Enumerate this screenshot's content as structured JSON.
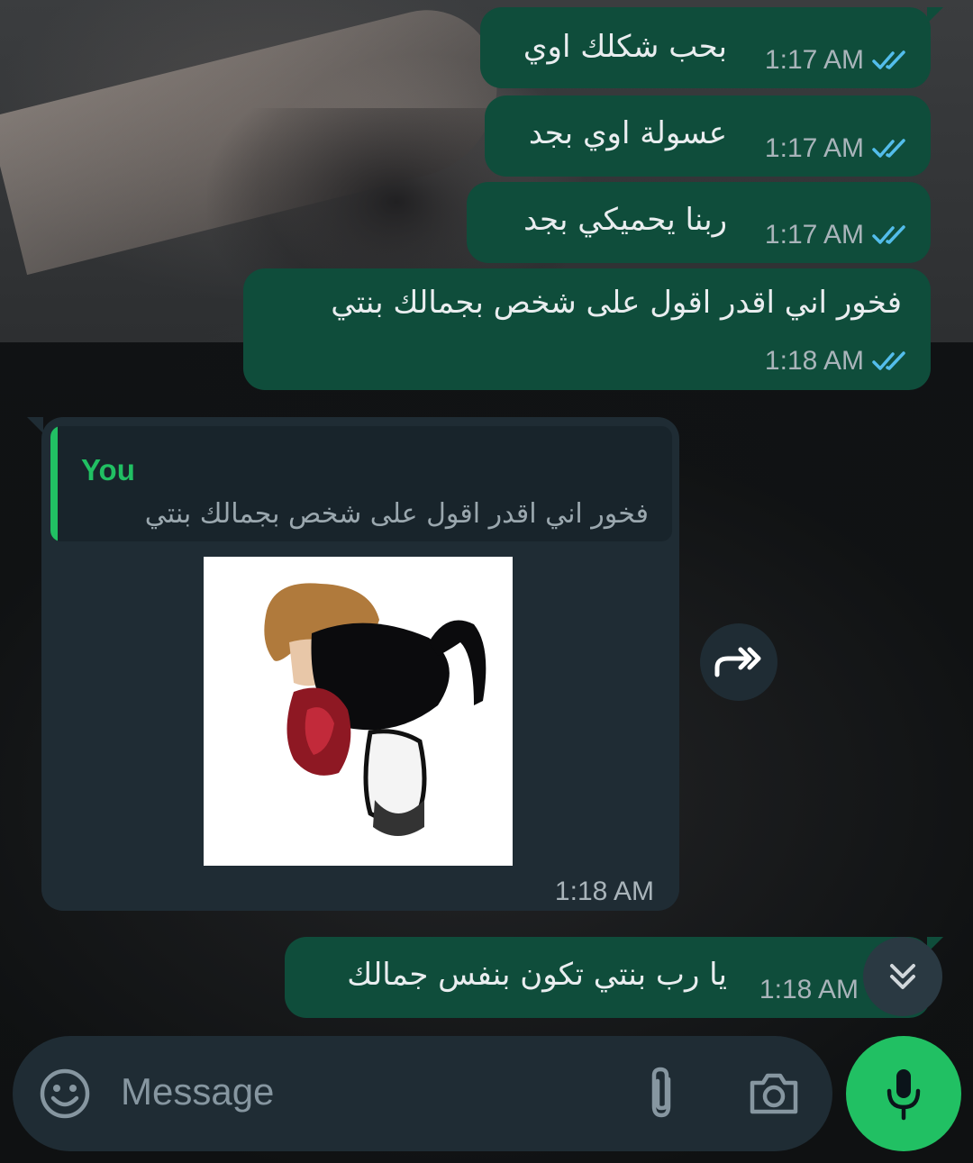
{
  "messages": [
    {
      "text": "بحب شكلك اوي",
      "time": "1:17 AM"
    },
    {
      "text": "عسولة اوي بجد",
      "time": "1:17 AM"
    },
    {
      "text": "ربنا يحميكي بجد",
      "time": "1:17 AM"
    },
    {
      "text": "فخور اني اقدر اقول على شخص بجمالك بنتي",
      "time": "1:18 AM"
    },
    {
      "text": "يا رب بنتي تكون بنفس جمالك",
      "time": "1:18 AM"
    }
  ],
  "reply": {
    "quote_author": "You",
    "quote_text": "فخور اني اقدر اقول على شخص بجمالك بنتي",
    "time": "1:18 AM"
  },
  "composer": {
    "placeholder": "Message"
  },
  "icons": {
    "read_receipt": "double-check-icon",
    "forward": "forward-icon",
    "scroll_down": "double-chevron-down-icon",
    "emoji": "emoji-icon",
    "attach": "paperclip-icon",
    "camera": "camera-icon",
    "mic": "microphone-icon"
  },
  "colors": {
    "outgoing_bubble": "#0f4d3b",
    "incoming_bubble": "#1f2c34",
    "read_ticks": "#53bdeb",
    "accent": "#21c063"
  }
}
